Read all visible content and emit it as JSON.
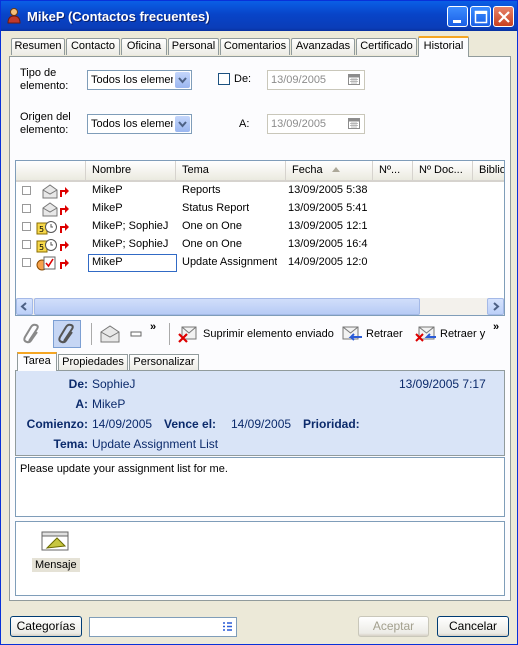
{
  "window": {
    "title": "MikeP (Contactos frecuentes)"
  },
  "tabs": [
    "Resumen",
    "Contacto",
    "Oficina",
    "Personal",
    "Comentarios",
    "Avanzadas",
    "Certificado",
    "Historial"
  ],
  "filters": {
    "tipo_label1": "Tipo de",
    "tipo_label2": "elemento:",
    "tipo_value": "Todos los elementos",
    "origen_label1": "Origen del",
    "origen_label2": "elemento:",
    "origen_value": "Todos los elementos",
    "de_label": "De:",
    "de_value": "13/09/2005",
    "a_label": "A:",
    "a_value": "13/09/2005"
  },
  "columns": [
    "Nombre",
    "Tema",
    "Fecha",
    "Nº...",
    "Nº Doc...",
    "Bibliot"
  ],
  "rows": [
    {
      "name": "MikeP",
      "subject": "Reports",
      "date": "13/09/2005 5:38",
      "icon": "mail-icon"
    },
    {
      "name": "MikeP",
      "subject": "Status Report",
      "date": "13/09/2005 5:41",
      "icon": "mail-icon"
    },
    {
      "name": "MikeP;  SophieJ",
      "subject": "One on One",
      "date": "13/09/2005 12:1",
      "icon": "appointment-icon"
    },
    {
      "name": "MikeP;  SophieJ",
      "subject": "One on One",
      "date": "13/09/2005 16:4",
      "icon": "appointment-icon"
    },
    {
      "name": "MikeP",
      "subject": "Update Assignment",
      "date": "14/09/2005 12:0",
      "icon": "task-icon"
    }
  ],
  "toolbar": {
    "suprimir": "Suprimir elemento enviado",
    "retraer": "Retraer",
    "retraer_y": "Retraer y",
    "more": "»"
  },
  "subtabs": [
    "Tarea",
    "Propiedades",
    "Personalizar"
  ],
  "detail": {
    "de_label": "De:",
    "de_value": "SophieJ",
    "date": "13/09/2005 7:17",
    "a_label": "A:",
    "a_value": "MikeP",
    "comienzo_label": "Comienzo:",
    "comienzo_value": "14/09/2005",
    "vence_label": "Vence el:",
    "vence_value": "14/09/2005",
    "prioridad_label": "Prioridad:",
    "tema_label": "Tema:",
    "tema_value": "Update Assignment List",
    "body": "Please update your assignment list for me."
  },
  "attachment": {
    "label": "Mensaje"
  },
  "buttons": {
    "categorias": "Categorías",
    "aceptar": "Aceptar",
    "cancelar": "Cancelar"
  }
}
